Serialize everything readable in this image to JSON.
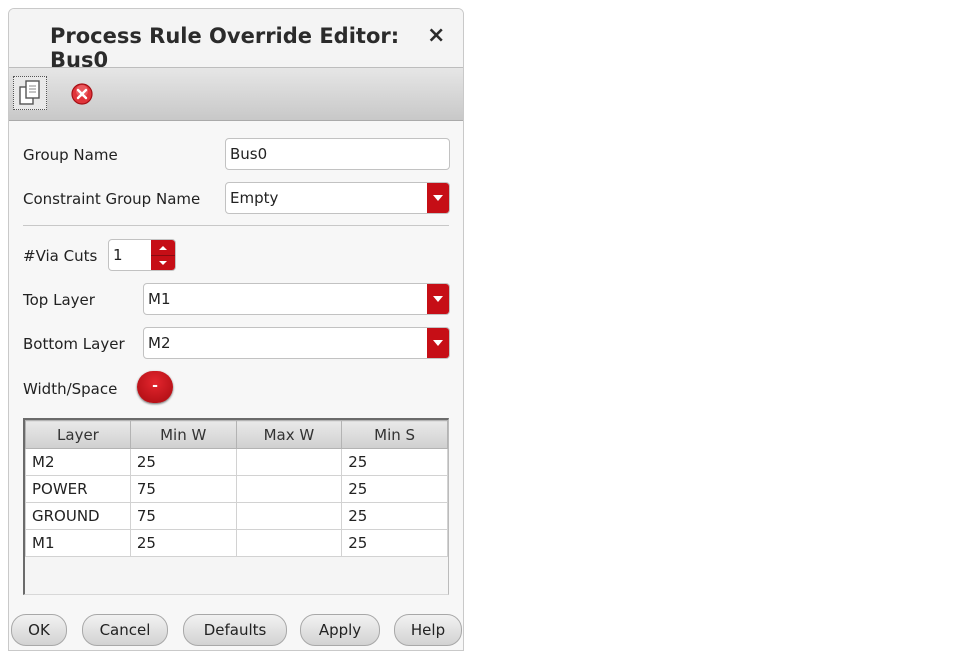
{
  "dialog": {
    "title": "Process Rule Override Editor: Bus0",
    "close_glyph": "×"
  },
  "toolbar": {
    "copy_icon": "copy-icon",
    "delete_icon": "delete-icon"
  },
  "form": {
    "group_name_label": "Group Name",
    "group_name_value": "Bus0",
    "constraint_group_label": "Constraint Group Name",
    "constraint_group_value": "Empty",
    "via_cuts_label": "#Via Cuts",
    "via_cuts_value": "1",
    "top_layer_label": "Top Layer",
    "top_layer_value": "M1",
    "bottom_layer_label": "Bottom Layer",
    "bottom_layer_value": "M2",
    "width_space_label": "Width/Space",
    "width_space_button": "-"
  },
  "table": {
    "columns": [
      "Layer",
      "Min W",
      "Max W",
      "Min S"
    ],
    "rows": [
      [
        "M2",
        "25",
        "",
        "25"
      ],
      [
        "POWER",
        "75",
        "",
        "25"
      ],
      [
        "GROUND",
        "75",
        "",
        "25"
      ],
      [
        "M1",
        "25",
        "",
        "25"
      ]
    ]
  },
  "buttons": {
    "ok": "OK",
    "cancel": "Cancel",
    "defaults": "Defaults",
    "apply": "Apply",
    "help": "Help"
  },
  "colors": {
    "accent_red": "#c60e16"
  }
}
